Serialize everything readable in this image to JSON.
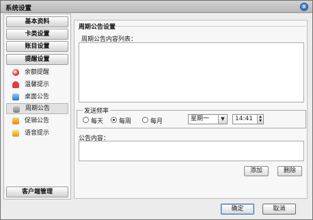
{
  "window": {
    "title": "系统设置"
  },
  "sidebar": {
    "sections_top": [
      "基本资料",
      "卡类设置",
      "账目设置",
      "提醒设置"
    ],
    "items": [
      {
        "label": "余额提醒",
        "icon": "coin-icon"
      },
      {
        "label": "温馨提示",
        "icon": "heart-icon"
      },
      {
        "label": "桌面公告",
        "icon": "desktop-icon"
      },
      {
        "label": "周期公告",
        "icon": "chat-icon"
      },
      {
        "label": "促销公告",
        "icon": "gift-icon"
      },
      {
        "label": "语音提示",
        "icon": "voice-icon"
      }
    ],
    "bottom_section": "客户端管理"
  },
  "main": {
    "title": "周期公告设置",
    "list_label": "周期公告内容列表：",
    "frequency": {
      "legend": "发送频率",
      "options": [
        "每天",
        "每周",
        "每月"
      ],
      "selected": "每周",
      "weekday": "星期一",
      "time": "14:41"
    },
    "content_label": "公告内容：",
    "add_label": "添加",
    "delete_label": "删除"
  },
  "footer": {
    "ok_label": "确定",
    "cancel_label": "取消"
  }
}
